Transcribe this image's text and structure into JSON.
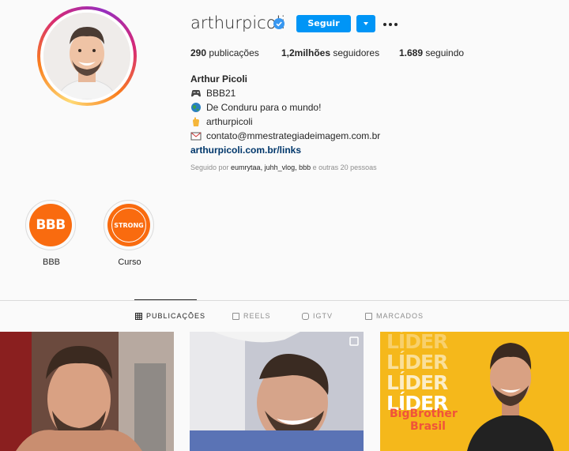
{
  "profile": {
    "username": "arthurpicoli",
    "follow_label": "Seguir",
    "stats": {
      "posts_count": "290",
      "posts_label": " publicações",
      "followers_count": "1,2milhões",
      "followers_label": " seguidores",
      "following_count": "1.689",
      "following_label": " seguindo"
    },
    "bio": {
      "full_name": "Arthur Picoli",
      "line1": "BBB21",
      "line2": "De Conduru para o mundo!",
      "line3": "arthurpicoli",
      "line4": "contato@mmestrategiadeimagem.com.br",
      "link": "arthurpicoli.com.br/links"
    },
    "followed_by": {
      "prefix": "Seguido por ",
      "names": "eumrytaa, juhh_vlog, bbb",
      "suffix": " e outras 20 pessoas"
    }
  },
  "highlights": [
    {
      "label": "BBB",
      "cover_text": "BBB"
    },
    {
      "label": "Curso",
      "cover_text": "STRONG"
    }
  ],
  "tabs": [
    {
      "label": "PUBLICAÇÕES",
      "icon": "grid-icon",
      "active": true
    },
    {
      "label": "REELS",
      "icon": "reels-icon",
      "active": false
    },
    {
      "label": "IGTV",
      "icon": "igtv-icon",
      "active": false
    },
    {
      "label": "MARCADOS",
      "icon": "tagged-icon",
      "active": false
    }
  ],
  "posts": [
    {
      "kind": "photo"
    },
    {
      "kind": "photo",
      "badge": "multiple-icon"
    },
    {
      "kind": "graphic",
      "repeated_text": "LÍDER",
      "brand_line1": "BigBrother",
      "brand_line2": "Brasil"
    }
  ],
  "colors": {
    "accent": "#0095f6",
    "verified": "#3897f0",
    "highlight": "#f96b0f",
    "link": "#00376b",
    "leader_bg": "#f5b81b"
  }
}
